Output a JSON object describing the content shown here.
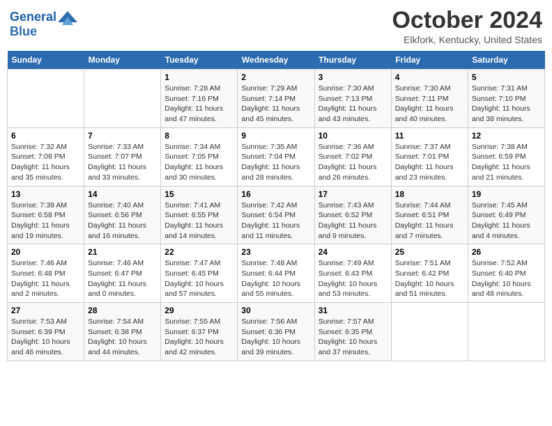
{
  "header": {
    "logo_line1": "General",
    "logo_line2": "Blue",
    "title": "October 2024",
    "subtitle": "Elkfork, Kentucky, United States"
  },
  "weekdays": [
    "Sunday",
    "Monday",
    "Tuesday",
    "Wednesday",
    "Thursday",
    "Friday",
    "Saturday"
  ],
  "weeks": [
    [
      {
        "day": "",
        "info": ""
      },
      {
        "day": "",
        "info": ""
      },
      {
        "day": "1",
        "info": "Sunrise: 7:28 AM\nSunset: 7:16 PM\nDaylight: 11 hours and 47 minutes."
      },
      {
        "day": "2",
        "info": "Sunrise: 7:29 AM\nSunset: 7:14 PM\nDaylight: 11 hours and 45 minutes."
      },
      {
        "day": "3",
        "info": "Sunrise: 7:30 AM\nSunset: 7:13 PM\nDaylight: 11 hours and 43 minutes."
      },
      {
        "day": "4",
        "info": "Sunrise: 7:30 AM\nSunset: 7:11 PM\nDaylight: 11 hours and 40 minutes."
      },
      {
        "day": "5",
        "info": "Sunrise: 7:31 AM\nSunset: 7:10 PM\nDaylight: 11 hours and 38 minutes."
      }
    ],
    [
      {
        "day": "6",
        "info": "Sunrise: 7:32 AM\nSunset: 7:08 PM\nDaylight: 11 hours and 35 minutes."
      },
      {
        "day": "7",
        "info": "Sunrise: 7:33 AM\nSunset: 7:07 PM\nDaylight: 11 hours and 33 minutes."
      },
      {
        "day": "8",
        "info": "Sunrise: 7:34 AM\nSunset: 7:05 PM\nDaylight: 11 hours and 30 minutes."
      },
      {
        "day": "9",
        "info": "Sunrise: 7:35 AM\nSunset: 7:04 PM\nDaylight: 11 hours and 28 minutes."
      },
      {
        "day": "10",
        "info": "Sunrise: 7:36 AM\nSunset: 7:02 PM\nDaylight: 11 hours and 26 minutes."
      },
      {
        "day": "11",
        "info": "Sunrise: 7:37 AM\nSunset: 7:01 PM\nDaylight: 11 hours and 23 minutes."
      },
      {
        "day": "12",
        "info": "Sunrise: 7:38 AM\nSunset: 6:59 PM\nDaylight: 11 hours and 21 minutes."
      }
    ],
    [
      {
        "day": "13",
        "info": "Sunrise: 7:39 AM\nSunset: 6:58 PM\nDaylight: 11 hours and 19 minutes."
      },
      {
        "day": "14",
        "info": "Sunrise: 7:40 AM\nSunset: 6:56 PM\nDaylight: 11 hours and 16 minutes."
      },
      {
        "day": "15",
        "info": "Sunrise: 7:41 AM\nSunset: 6:55 PM\nDaylight: 11 hours and 14 minutes."
      },
      {
        "day": "16",
        "info": "Sunrise: 7:42 AM\nSunset: 6:54 PM\nDaylight: 11 hours and 11 minutes."
      },
      {
        "day": "17",
        "info": "Sunrise: 7:43 AM\nSunset: 6:52 PM\nDaylight: 11 hours and 9 minutes."
      },
      {
        "day": "18",
        "info": "Sunrise: 7:44 AM\nSunset: 6:51 PM\nDaylight: 11 hours and 7 minutes."
      },
      {
        "day": "19",
        "info": "Sunrise: 7:45 AM\nSunset: 6:49 PM\nDaylight: 11 hours and 4 minutes."
      }
    ],
    [
      {
        "day": "20",
        "info": "Sunrise: 7:46 AM\nSunset: 6:48 PM\nDaylight: 11 hours and 2 minutes."
      },
      {
        "day": "21",
        "info": "Sunrise: 7:46 AM\nSunset: 6:47 PM\nDaylight: 11 hours and 0 minutes."
      },
      {
        "day": "22",
        "info": "Sunrise: 7:47 AM\nSunset: 6:45 PM\nDaylight: 10 hours and 57 minutes."
      },
      {
        "day": "23",
        "info": "Sunrise: 7:48 AM\nSunset: 6:44 PM\nDaylight: 10 hours and 55 minutes."
      },
      {
        "day": "24",
        "info": "Sunrise: 7:49 AM\nSunset: 6:43 PM\nDaylight: 10 hours and 53 minutes."
      },
      {
        "day": "25",
        "info": "Sunrise: 7:51 AM\nSunset: 6:42 PM\nDaylight: 10 hours and 51 minutes."
      },
      {
        "day": "26",
        "info": "Sunrise: 7:52 AM\nSunset: 6:40 PM\nDaylight: 10 hours and 48 minutes."
      }
    ],
    [
      {
        "day": "27",
        "info": "Sunrise: 7:53 AM\nSunset: 6:39 PM\nDaylight: 10 hours and 46 minutes."
      },
      {
        "day": "28",
        "info": "Sunrise: 7:54 AM\nSunset: 6:38 PM\nDaylight: 10 hours and 44 minutes."
      },
      {
        "day": "29",
        "info": "Sunrise: 7:55 AM\nSunset: 6:37 PM\nDaylight: 10 hours and 42 minutes."
      },
      {
        "day": "30",
        "info": "Sunrise: 7:56 AM\nSunset: 6:36 PM\nDaylight: 10 hours and 39 minutes."
      },
      {
        "day": "31",
        "info": "Sunrise: 7:57 AM\nSunset: 6:35 PM\nDaylight: 10 hours and 37 minutes."
      },
      {
        "day": "",
        "info": ""
      },
      {
        "day": "",
        "info": ""
      }
    ]
  ]
}
